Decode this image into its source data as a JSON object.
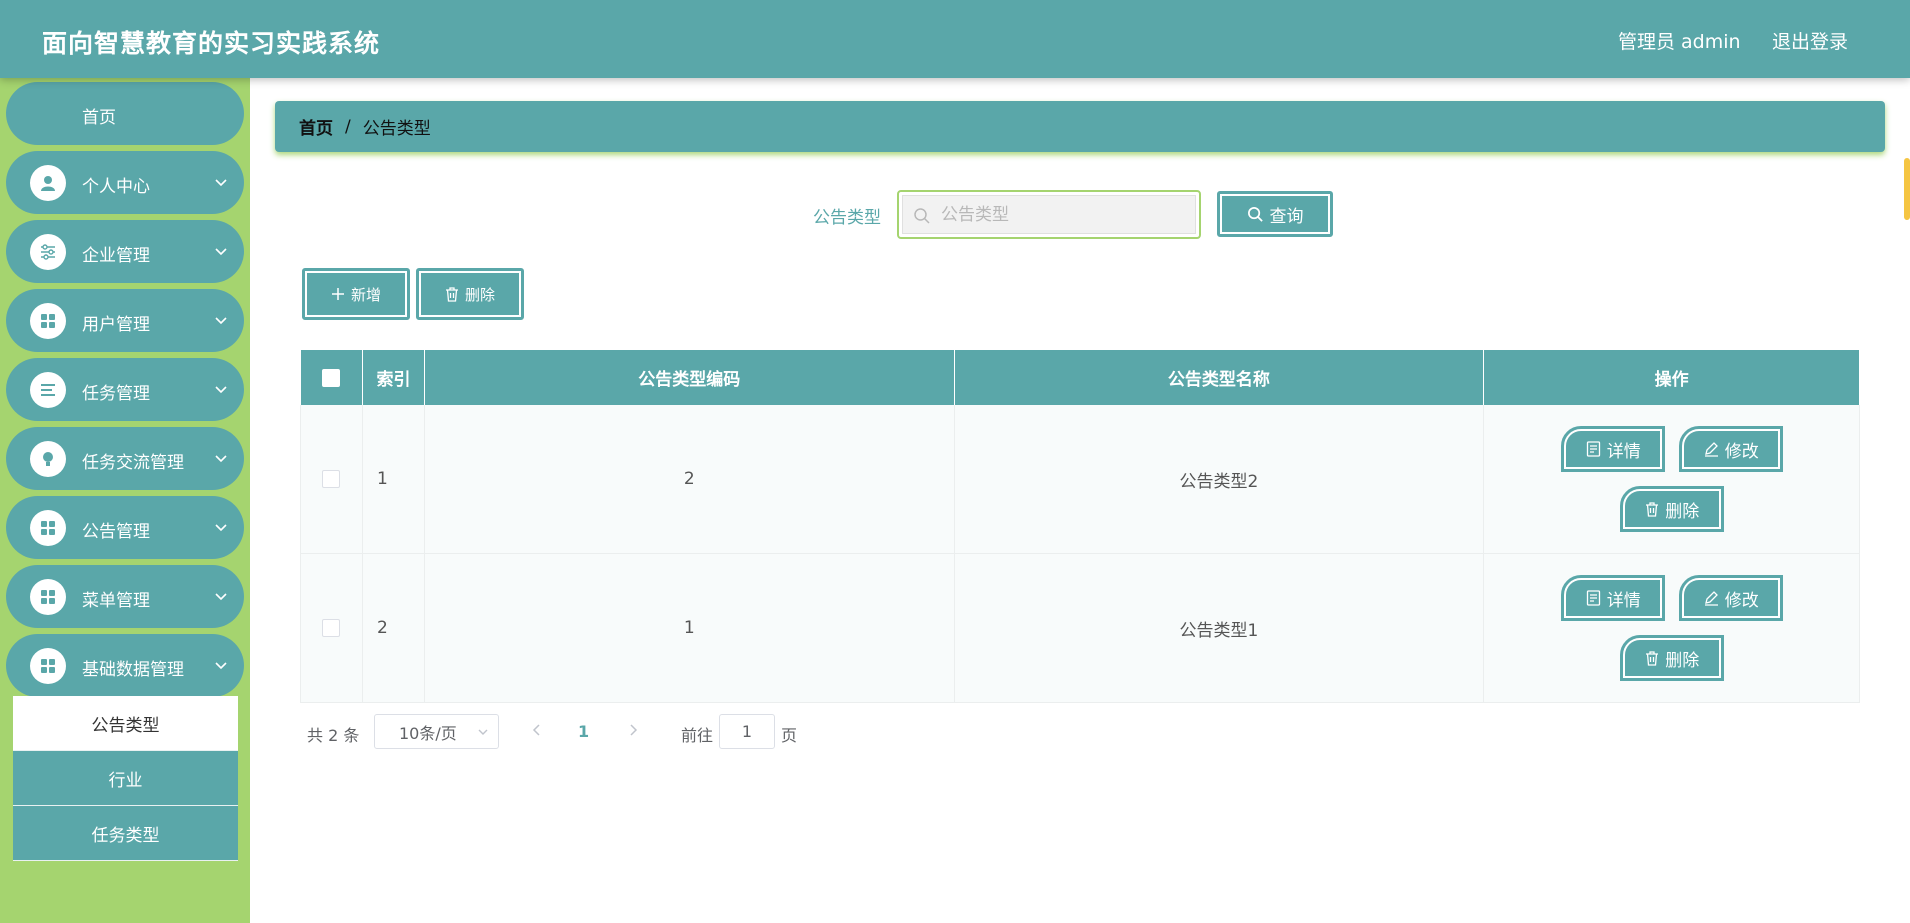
{
  "header": {
    "title": "面向智慧教育的实习实践系统",
    "user": "管理员 admin",
    "logout": "退出登录"
  },
  "sidebar": {
    "items": [
      {
        "label": "首页",
        "icon": "home"
      },
      {
        "label": "个人中心",
        "icon": "user-icon"
      },
      {
        "label": "企业管理",
        "icon": "sliders-icon"
      },
      {
        "label": "用户管理",
        "icon": "grid-icon"
      },
      {
        "label": "任务管理",
        "icon": "list-icon"
      },
      {
        "label": "任务交流管理",
        "icon": "bulb-icon"
      },
      {
        "label": "公告管理",
        "icon": "grid-icon"
      },
      {
        "label": "菜单管理",
        "icon": "grid-icon"
      },
      {
        "label": "基础数据管理",
        "icon": "grid-icon"
      }
    ],
    "submenu": [
      "公告类型",
      "行业",
      "任务类型"
    ]
  },
  "breadcrumb": {
    "home": "首页",
    "separator": "/",
    "current": "公告类型"
  },
  "search": {
    "label": "公告类型",
    "placeholder": "公告类型",
    "button": "查询"
  },
  "actions": {
    "add": "新增",
    "delete": "删除"
  },
  "table": {
    "headers": {
      "index": "索引",
      "code": "公告类型编码",
      "name": "公告类型名称",
      "ops": "操作"
    },
    "rows": [
      {
        "index": "1",
        "code": "2",
        "name": "公告类型2"
      },
      {
        "index": "2",
        "code": "1",
        "name": "公告类型1"
      }
    ],
    "op_labels": {
      "detail": "详情",
      "edit": "修改",
      "delete": "删除"
    }
  },
  "pagination": {
    "total": "共 2 条",
    "page_size": "10条/页",
    "current_page": "1",
    "goto_prefix": "前往",
    "goto_value": "1",
    "goto_suffix": "页"
  },
  "colors": {
    "primary": "#5aa7a9",
    "sidebar_bg": "#a5d46f"
  }
}
